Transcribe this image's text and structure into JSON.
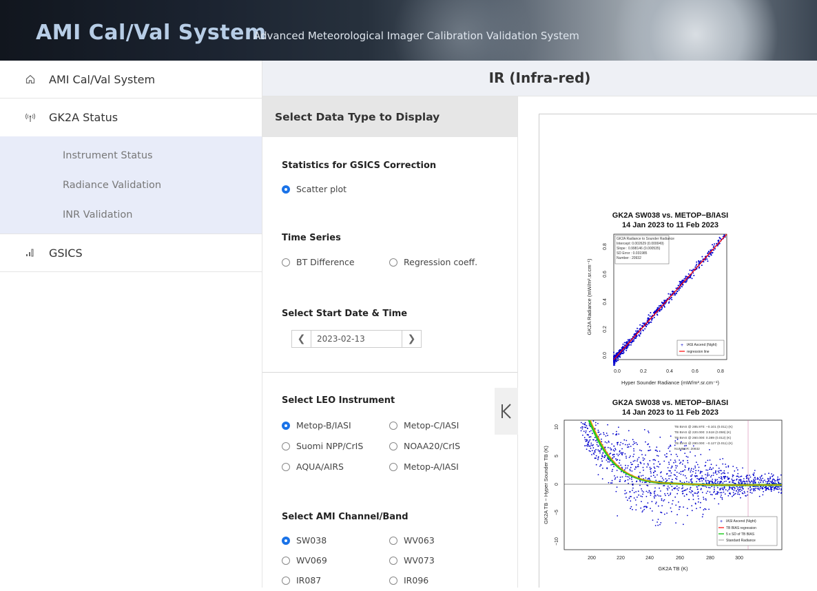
{
  "header": {
    "title": "AMI Cal/Val System",
    "subtitle": "Advanced Meteorological Imager Calibration Validation System"
  },
  "sidebar": {
    "home": {
      "label": "AMI Cal/Val System",
      "icon": "home-icon"
    },
    "status": {
      "label": "GK2A Status",
      "icon": "antenna-icon"
    },
    "sub_items": [
      "Instrument Status",
      "Radiance Validation",
      "INR Validation"
    ],
    "gsics": {
      "label": "GSICS",
      "icon": "signal-bars-icon"
    }
  },
  "page_title": "IR (Infra-red)",
  "panel": {
    "heading": "Select Data Type to Display",
    "gsics_section": {
      "title": "Statistics for GSICS Correction",
      "options": [
        "Scatter plot"
      ],
      "selected": 0
    },
    "timeseries_section": {
      "title": "Time Series",
      "options": [
        "BT Difference",
        "Regression coeff."
      ]
    },
    "date_section": {
      "title": "Select Start Date & Time",
      "date": "2023-02-13",
      "prev_icon": "chevron-left-icon",
      "next_icon": "chevron-right-icon"
    },
    "leo_section": {
      "title": "Select LEO Instrument",
      "options": [
        "Metop-B/IASI",
        "Metop-C/IASI",
        "Suomi NPP/CrIS",
        "NOAA20/CrIS",
        "AQUA/AIRS",
        "Metop-A/IASI"
      ],
      "selected": 0
    },
    "channel_section": {
      "title": "Select AMI Channel/Band",
      "options": [
        "SW038",
        "WV063",
        "WV069",
        "WV073",
        "IR087",
        "IR096"
      ],
      "selected": 0
    }
  },
  "collapse_icon": "collapse-left-icon",
  "colors": {
    "accent": "#1a73e8",
    "submenu_bg": "#e8ecf9",
    "scatter": "#0000cc",
    "regression": "#ff0000"
  },
  "plot1": {
    "title1": "GK2A SW038 vs. METOP−B/IASI",
    "title2": "14 Jan 2023 to 11 Feb 2023",
    "ylabel": "GK2A Radiance (mW/m².sr.cm⁻¹)",
    "xlabel": "Hyper Sounder Radiance (mW/m².sr.cm⁻¹)",
    "xticks": [
      "0.0",
      "0.2",
      "0.4",
      "0.6",
      "0.8"
    ],
    "yticks": [
      "0.0",
      "0.2",
      "0.4",
      "0.6",
      "0.8"
    ],
    "stats": [
      "GK2A Radiance to Sounder Radiance",
      "Intercept:  0.002629 (0.000049)",
      "Slope    :  0.998146 (0.000535)",
      "SD Error :  0.031985",
      "Number   :  20932"
    ],
    "legend": [
      "IASI Ascend (Night)",
      "regression line"
    ]
  },
  "plot2": {
    "title1": "GK2A SW038 vs. METOP−B/IASI",
    "title2": "14 Jan 2023 to 11 Feb 2023",
    "ylabel": "GK2A TB − Hyper Sounder TB (K)",
    "xlabel": "GK2A TB (K)",
    "xticks": [
      "200",
      "220",
      "240",
      "260",
      "280",
      "300"
    ],
    "yticks": [
      "10",
      "5",
      "0",
      "−5",
      "−10"
    ],
    "stats": [
      "TB BIAS @ 285.970:  −0.101 (0.011)  (K)",
      "TB BIAS @ 220.000:   3.518 (0.059)  (K)",
      "TB BIAS @ 260.000:   0.389 (0.012)  (K)",
      "TB BIAS @ 290.000:  −0.127 (0.011)  (K)",
      "NUMBER:   20932"
    ],
    "legend": [
      "IASI Ascend (Night)",
      "TB BIAS regression",
      "5 x SD of TB BIAS",
      "Standard Radiance"
    ]
  }
}
